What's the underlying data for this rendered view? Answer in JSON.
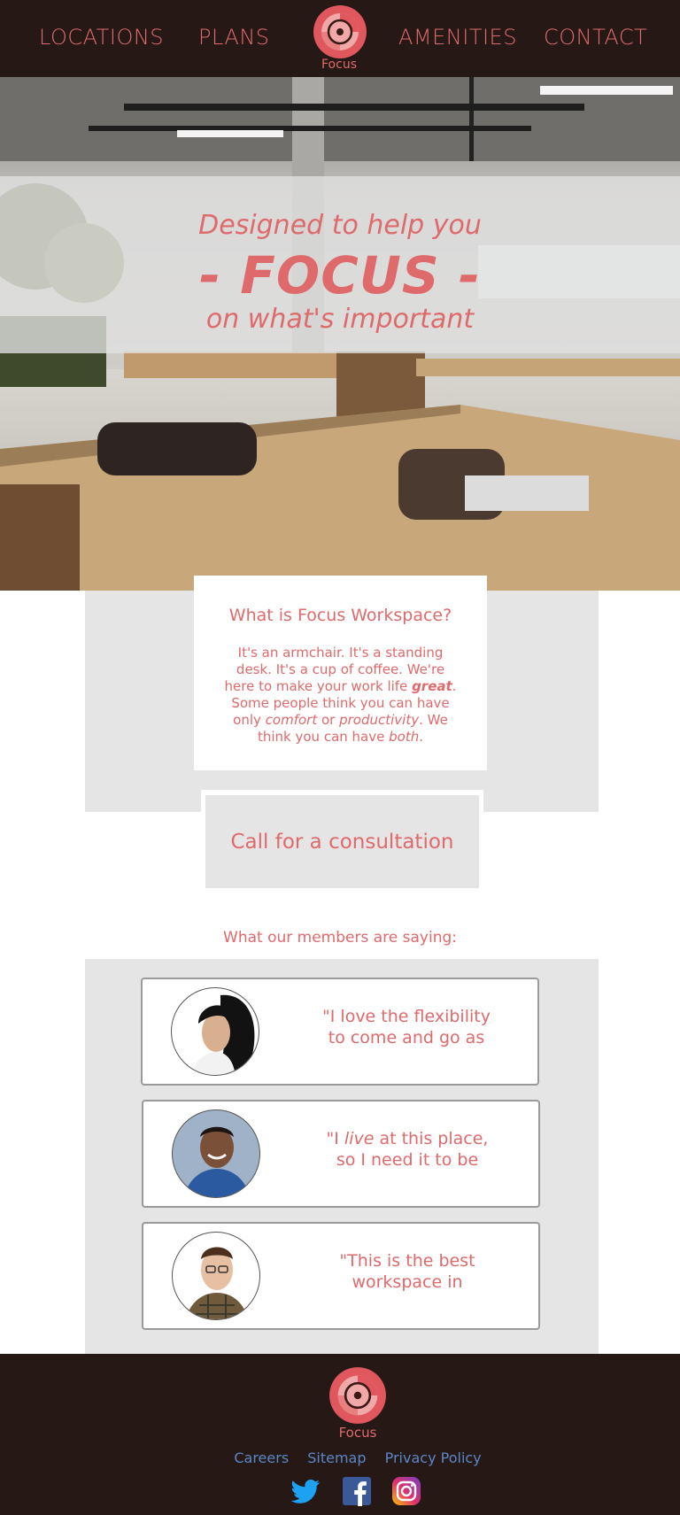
{
  "header": {
    "nav_left": [
      "LOCATIONS",
      "PLANS"
    ],
    "nav_right": [
      "AMENITIES",
      "CONTACT"
    ],
    "logo_text": "Focus"
  },
  "hero": {
    "line1": "Designed to help you",
    "line2": "- FOCUS -",
    "line3": "on what's important"
  },
  "about": {
    "title": "What is Focus Workspace?",
    "text_part1": "It's an armchair. It's a standing desk. It's a cup of coffee. We're here to make your work life ",
    "text_em1": "great",
    "text_part2": ". Some people think you can have only ",
    "text_em2": "comfort",
    "text_part3": " or ",
    "text_em3": "productivity",
    "text_part4": ". We think you can have ",
    "text_em4": "both",
    "text_part5": "."
  },
  "cta": {
    "label": "Call for a consultation"
  },
  "testimonials": {
    "heading": "What our members are saying:",
    "items": [
      {
        "quote_a": "\"I love the flexibility",
        "quote_b": "to come and go as"
      },
      {
        "quote_a1": "\"I ",
        "quote_em": "live",
        "quote_a2": " at this place,",
        "quote_b": "so I need it to be"
      },
      {
        "quote_a": "\"This is the best",
        "quote_b": "workspace in"
      }
    ]
  },
  "footer": {
    "logo_text": "Focus",
    "links": [
      "Careers",
      "Sitemap",
      "Privacy Policy"
    ],
    "social": [
      "twitter-icon",
      "facebook-icon",
      "instagram-icon"
    ]
  },
  "colors": {
    "header_bg": "#261915",
    "accent": "#df6a6b",
    "panel_gray": "#e5e5e5",
    "link_blue": "#5b86c6"
  }
}
